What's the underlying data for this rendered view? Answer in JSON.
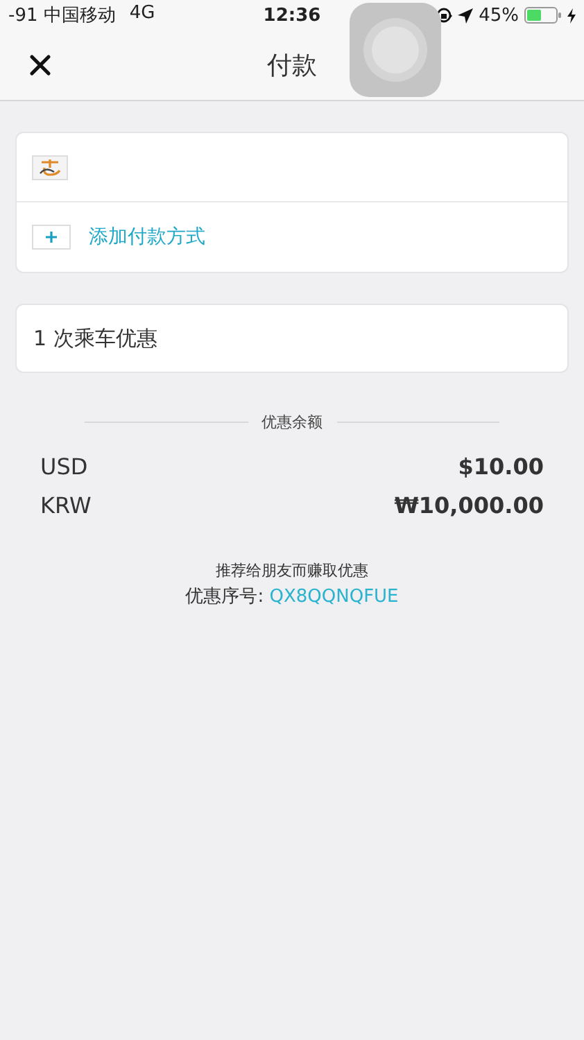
{
  "status_bar": {
    "carrier": "-91 中国移动",
    "network": "4G",
    "time": "12:36",
    "battery": "45%"
  },
  "nav": {
    "title": "付款"
  },
  "payment": {
    "add_label": "添加付款方式"
  },
  "promo": {
    "label": "1 次乘车优惠"
  },
  "balance": {
    "title": "优惠余额",
    "rows": [
      {
        "currency": "USD",
        "amount": "$10.00"
      },
      {
        "currency": "KRW",
        "amount": "₩10,000.00"
      }
    ]
  },
  "referral": {
    "text": "推荐给朋友而赚取优惠",
    "code_label": "优惠序号:",
    "code": "QX8QQNQFUE"
  }
}
